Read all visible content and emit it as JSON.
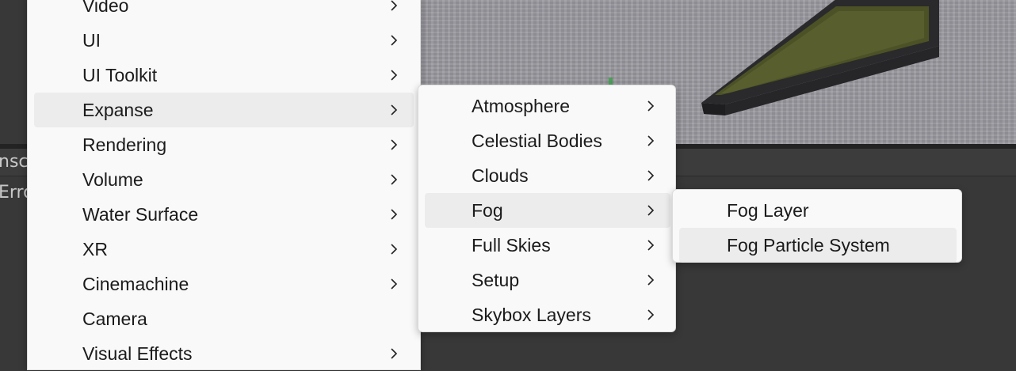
{
  "background": {
    "console_fragments": [
      "nsc",
      "Erro"
    ]
  },
  "main_menu": {
    "items": [
      {
        "label": "Video",
        "has_submenu": true
      },
      {
        "label": "UI",
        "has_submenu": true
      },
      {
        "label": "UI Toolkit",
        "has_submenu": true
      },
      {
        "label": "Expanse",
        "has_submenu": true,
        "highlighted": true
      },
      {
        "label": "Rendering",
        "has_submenu": true
      },
      {
        "label": "Volume",
        "has_submenu": true
      },
      {
        "label": "Water Surface",
        "has_submenu": true
      },
      {
        "label": "XR",
        "has_submenu": true
      },
      {
        "label": "Cinemachine",
        "has_submenu": true
      },
      {
        "label": "Camera",
        "has_submenu": false
      },
      {
        "label": "Visual Effects",
        "has_submenu": true
      }
    ]
  },
  "expanse_menu": {
    "items": [
      {
        "label": "Atmosphere",
        "has_submenu": true
      },
      {
        "label": "Celestial Bodies",
        "has_submenu": true
      },
      {
        "label": "Clouds",
        "has_submenu": true
      },
      {
        "label": "Fog",
        "has_submenu": true,
        "highlighted": true
      },
      {
        "label": "Full Skies",
        "has_submenu": true
      },
      {
        "label": "Setup",
        "has_submenu": true
      },
      {
        "label": "Skybox Layers",
        "has_submenu": true
      }
    ]
  },
  "fog_menu": {
    "items": [
      {
        "label": "Fog Layer",
        "has_submenu": false
      },
      {
        "label": "Fog Particle System",
        "has_submenu": false,
        "highlighted": true
      }
    ]
  },
  "colors": {
    "menu_bg": "#f9f9f9",
    "highlight": "#ececec",
    "text": "#1b1b1b",
    "editor_bg": "#383838"
  }
}
